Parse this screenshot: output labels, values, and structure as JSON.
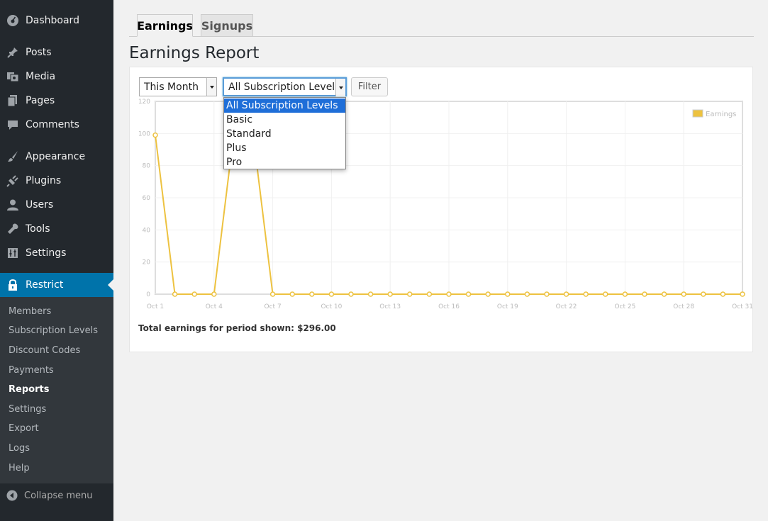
{
  "sidebar": {
    "items": [
      {
        "label": "Dashboard",
        "icon": "dashboard-icon"
      },
      {
        "label": "Posts",
        "icon": "pin-icon"
      },
      {
        "label": "Media",
        "icon": "media-icon"
      },
      {
        "label": "Pages",
        "icon": "pages-icon"
      },
      {
        "label": "Comments",
        "icon": "comment-icon"
      },
      {
        "label": "Appearance",
        "icon": "brush-icon"
      },
      {
        "label": "Plugins",
        "icon": "plug-icon"
      },
      {
        "label": "Users",
        "icon": "user-icon"
      },
      {
        "label": "Tools",
        "icon": "wrench-icon"
      },
      {
        "label": "Settings",
        "icon": "settings-icon"
      },
      {
        "label": "Restrict",
        "icon": "lock-icon"
      }
    ],
    "submenu": [
      "Members",
      "Subscription Levels",
      "Discount Codes",
      "Payments",
      "Reports",
      "Settings",
      "Export",
      "Logs",
      "Help"
    ],
    "current_submenu": "Reports",
    "collapse_label": "Collapse menu"
  },
  "tabs": [
    {
      "label": "Earnings",
      "active": true
    },
    {
      "label": "Signups",
      "active": false
    }
  ],
  "page_title": "Earnings Report",
  "filters": {
    "period_value": "This Month",
    "level_value": "All Subscription Levels",
    "level_options": [
      "All Subscription Levels",
      "Basic",
      "Standard",
      "Plus",
      "Pro"
    ],
    "filter_label": "Filter"
  },
  "chart_data": {
    "type": "line",
    "x": [
      1,
      2,
      3,
      4,
      5,
      6,
      7,
      8,
      9,
      10,
      11,
      12,
      13,
      14,
      15,
      16,
      17,
      18,
      19,
      20,
      21,
      22,
      23,
      24,
      25,
      26,
      27,
      28,
      29,
      30,
      31
    ],
    "x_tick_labels": [
      "Oct 1",
      "Oct 4",
      "Oct 7",
      "Oct 10",
      "Oct 13",
      "Oct 16",
      "Oct 19",
      "Oct 22",
      "Oct 25",
      "Oct 28",
      "Oct 31"
    ],
    "x_tick_values": [
      1,
      4,
      7,
      10,
      13,
      16,
      19,
      22,
      25,
      28,
      31
    ],
    "series": [
      {
        "name": "Earnings",
        "color": "#edc240",
        "values": [
          99,
          0,
          0,
          0,
          99,
          99,
          0,
          0,
          0,
          0,
          0,
          0,
          0,
          0,
          0,
          0,
          0,
          0,
          0,
          0,
          0,
          0,
          0,
          0,
          0,
          0,
          0,
          0,
          0,
          0,
          0
        ]
      }
    ],
    "y_ticks": [
      0,
      20,
      40,
      60,
      80,
      100,
      120
    ],
    "ylim": [
      0,
      120
    ],
    "legend": "top-right",
    "grid": true
  },
  "total_text": "Total earnings for period shown: $296.00"
}
